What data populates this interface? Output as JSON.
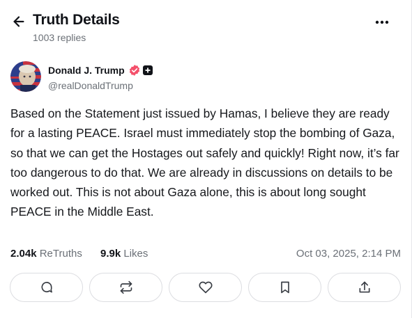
{
  "header": {
    "title": "Truth Details",
    "reply_count": "1003 replies",
    "back_icon": "arrow-left-icon",
    "more_icon": "more-horizontal-icon"
  },
  "author": {
    "name": "Donald J. Trump",
    "handle": "@realDonaldTrump",
    "verified_color": "#f4506b",
    "avatar_icon": "avatar-image"
  },
  "post": {
    "text": "Based on the Statement just issued by Hamas, I believe they are ready for a lasting PEACE. Israel must immediately stop the bombing of Gaza, so that we can get the Hostages out safely and quickly! Right now, it’s far too dangerous to do that. We are already in discussions on details to be worked out. This is not about Gaza alone, this is about long sought PEACE in the Middle East."
  },
  "stats": {
    "retruths_count": "2.04k",
    "retruths_label": "ReTruths",
    "likes_count": "9.9k",
    "likes_label": "Likes",
    "timestamp": "Oct 03, 2025, 2:14 PM"
  },
  "actions": [
    "reply-icon",
    "retruth-icon",
    "like-icon",
    "bookmark-icon",
    "share-icon"
  ]
}
